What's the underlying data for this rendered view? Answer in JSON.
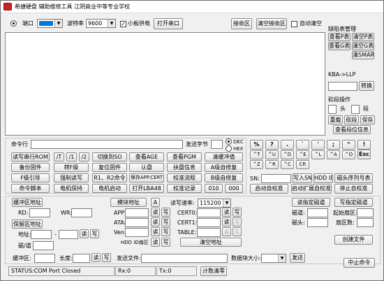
{
  "title": "希捷硬盘 辅助维修工具    江阴商业中等专业学校",
  "top": {
    "port_label": "端口",
    "baud_label": "波特率",
    "baud_value": "9600",
    "board_power_label": "小板供电",
    "open_port": "打开串口",
    "recv_area": "接收区",
    "clear_recv": "清空接收区",
    "auto_clear": "自动清空"
  },
  "right": {
    "defect_title": "缺陷表管理",
    "view_p": "查看P表",
    "clear_p": "清空P表",
    "view_g": "查看G表",
    "clear_g": "清空G表",
    "clear_smart": "清SMART",
    "kba_title": "KBA->LLP",
    "convert": "转换",
    "module_title": "砍段操作",
    "head_label": "头",
    "seg_label": "段",
    "reset": "重载",
    "cut": "砍段",
    "save": "保存",
    "view_seg": "查看段位信息"
  },
  "cmd": {
    "cmd_label": "命令行",
    "send_bytes": "发送字节",
    "dec": "DEC",
    "hex": "HEX"
  },
  "grid_left": {
    "rows": [
      [
        "读写串行ROM",
        "/T",
        "/1",
        "/2",
        "切换到SO",
        "查看AGE",
        "查看PGM",
        "清缓冲值"
      ],
      [
        "备份固件",
        "转F级",
        "复位固件",
        "认盘",
        "扶盘信息",
        "A级自修复"
      ],
      [
        "F级引导",
        "强制读写",
        "R1、R2命令",
        "保存APP.CERT",
        "校准流程",
        "B级自修复"
      ],
      [
        "命令脚本",
        "电机保持",
        "电机启动",
        "打开LBA48",
        "校准记录",
        "010",
        "000"
      ]
    ]
  },
  "symbols": [
    "%",
    "?",
    ".",
    "`",
    "'",
    ";",
    "^",
    "!",
    "^T",
    "^U",
    "^D",
    "^E",
    "^L",
    "^A",
    "^O",
    "Esc",
    "^Z",
    "^R",
    "^C",
    "CR"
  ],
  "sn": {
    "sn_label": "SN:",
    "write_sn": "写入SN",
    "hdd_id": "HDD ID",
    "head_map": "磁头序列号表",
    "startup": "启动自校准",
    "start_ext": "启动扩展自校准",
    "stop": "停止自校准"
  },
  "buffer": {
    "buf_addr": "缓冲区地址",
    "rd": "RD:",
    "wr": "WR:",
    "reserve_addr": "保留区地址",
    "addr": "地址:",
    "dash": "-",
    "read": "读",
    "write": "写",
    "cyl": "磁/道",
    "module_addr": "模块地址",
    "a": "A",
    "app": "APP:",
    "ata": "ATA:",
    "ven": "Ven:",
    "hdd_id_sector": "HDD ID扇区",
    "rw_rate": "读写速率:",
    "rate_value": "115200",
    "cert": "CERT0:",
    "cert1": "CERT1:",
    "table": "TABLE:",
    "clear_addr": "清空地址",
    "read_track": "读指定磁道",
    "write_track": "写指定磁道",
    "track": "磁道:",
    "start_sector": "起始扇区:",
    "head": "磁头:",
    "sectors": "扇区数:",
    "create_file": "创建文件",
    "buf_label": "缓冲区:",
    "length": "长度:",
    "send_file": "发送文件:",
    "block_size": "数据块大小:",
    "send": "发送",
    "stop_cmd": "中止命令"
  },
  "statusbar": {
    "status": "STATUS:COM Port Closed",
    "rx": "Rx:0",
    "tx": "Tx:0",
    "counter_clear": "计数清零"
  }
}
